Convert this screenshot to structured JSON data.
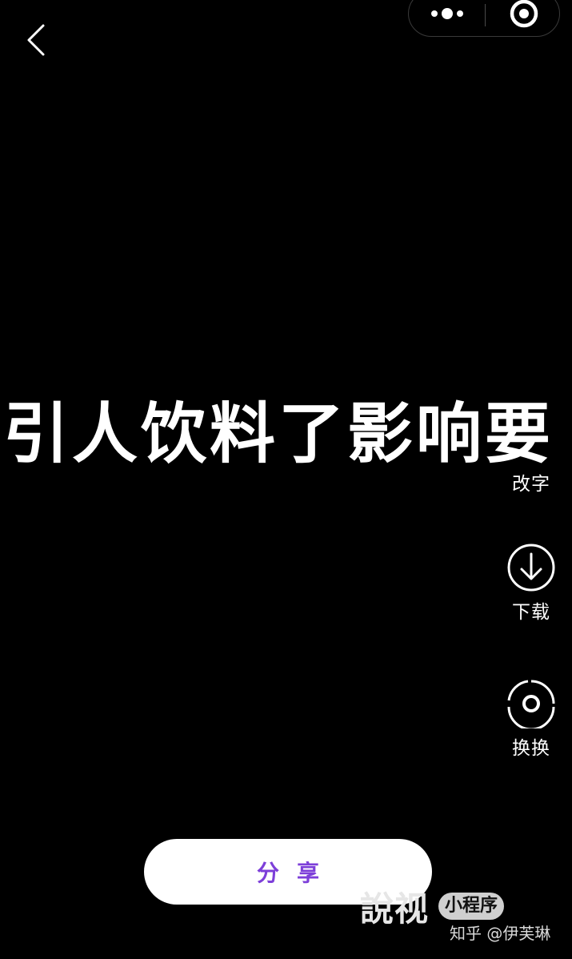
{
  "nav": {
    "back_icon": "chevron-left-icon",
    "capsule_more_icon": "more-dots-icon",
    "capsule_close_icon": "target-icon"
  },
  "banner": {
    "text": "引人饮料了影响要"
  },
  "side_actions": [
    {
      "label": "改字",
      "icon": "edit-text-icon"
    },
    {
      "label": "下载",
      "icon": "download-circle-icon"
    },
    {
      "label": "换换",
      "icon": "swap-ring-icon"
    }
  ],
  "share_button": {
    "label": "分享"
  },
  "watermark": {
    "logo_text": "說视",
    "badge": "小程序"
  },
  "credit": "知乎 @伊芙琳",
  "colors": {
    "background": "#000000",
    "share_text": "#7d3fd9",
    "share_bg": "#ffffff"
  }
}
